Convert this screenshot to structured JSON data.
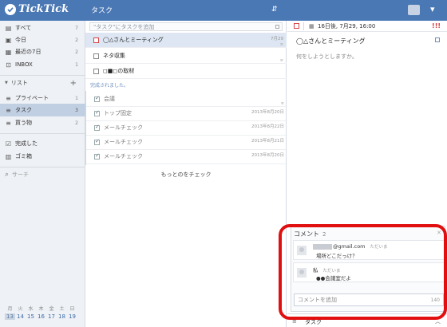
{
  "app": {
    "name": "TickTick",
    "list_title": "タスク"
  },
  "sidebar": {
    "smart": [
      {
        "label": "すべて",
        "count": "7",
        "icon": "stack-icon"
      },
      {
        "label": "今日",
        "count": "2",
        "icon": "today-icon"
      },
      {
        "label": "最近の7日",
        "count": "2",
        "icon": "week-icon"
      },
      {
        "label": "INBOX",
        "count": "1",
        "icon": "inbox-icon"
      }
    ],
    "lists_header": "リスト",
    "lists": [
      {
        "label": "プライベート",
        "count": "1"
      },
      {
        "label": "タスク",
        "count": "3"
      },
      {
        "label": "買う物",
        "count": "2"
      }
    ],
    "completed": "完成した",
    "trash": "ゴミ箱",
    "search": "サーチ",
    "calendar": {
      "days": [
        "月",
        "火",
        "水",
        "木",
        "金",
        "土",
        "日"
      ],
      "dates": [
        "13",
        "14",
        "15",
        "16",
        "17",
        "18",
        "19"
      ]
    }
  },
  "tasks": {
    "add_placeholder": "\"タスク\"にタスクを追加",
    "items": [
      {
        "title": "◯△さんとミーティング",
        "date": "7月29"
      },
      {
        "title": "ネタ収集",
        "date": ""
      },
      {
        "title": "◻■◻の取材",
        "date": ""
      }
    ],
    "completed_header": "完成されました。",
    "completed_items": [
      {
        "title": "会議",
        "date": ""
      },
      {
        "title": "トップ固定",
        "date": "2013年8月20日"
      },
      {
        "title": "メールチェック",
        "date": "2013年8月22日"
      },
      {
        "title": "メールチェック",
        "date": "2013年8月21日"
      },
      {
        "title": "メールチェック",
        "date": "2013年8月20日"
      }
    ],
    "more": "もっとのをチェック"
  },
  "detail": {
    "due": "16日後, 7月29, 16:00",
    "priority": "!!!",
    "title": "◯△さんとミーティング",
    "placeholder": "何をしようとしますか。",
    "comments": {
      "header": "コメント",
      "count": "2",
      "items": [
        {
          "author": "@gmail.com",
          "time": "ただいま",
          "text": "場所どこだっけ？"
        },
        {
          "author": "私",
          "time": "ただいま",
          "text": "●●会議室だよ"
        }
      ],
      "input_placeholder": "コメントを追加",
      "limit": "140"
    },
    "tag_bar": "タスク"
  },
  "colors": {
    "brand": "#4a78b5",
    "priority": "#d43a3a",
    "highlight": "#e10f0f"
  }
}
